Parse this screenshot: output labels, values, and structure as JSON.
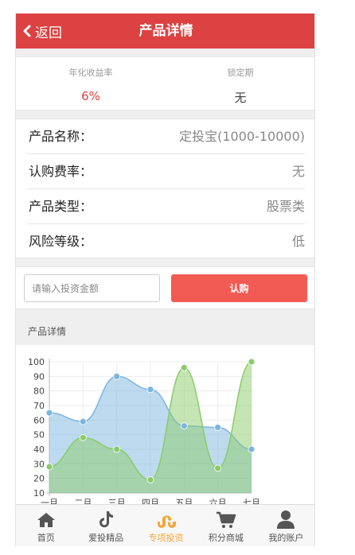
{
  "header": {
    "back_label": "返回",
    "title": "产品详情"
  },
  "rates": [
    {
      "label": "年化收益率",
      "value": "6%",
      "color": "#db4241"
    },
    {
      "label": "锁定期",
      "value": "无",
      "color": "#444444"
    }
  ],
  "info": [
    {
      "key": "产品名称：",
      "value": "定投宝(1000-10000)"
    },
    {
      "key": "认购费率：",
      "value": "无"
    },
    {
      "key": "产品类型：",
      "value": "股票类"
    },
    {
      "key": "风险等级：",
      "value": "低"
    }
  ],
  "buy": {
    "placeholder": "请输入投资金额",
    "button_label": "认购"
  },
  "section": {
    "title": "产品详情"
  },
  "chart_data": {
    "type": "area",
    "x": [
      "一月",
      "二月",
      "三月",
      "四月",
      "五月",
      "六月",
      "七月"
    ],
    "ylim": [
      10,
      100
    ],
    "yticks": [
      10,
      20,
      30,
      40,
      50,
      60,
      70,
      80,
      90,
      100
    ],
    "grid": true,
    "series": [
      {
        "values": [
          65,
          59,
          90,
          81,
          56,
          55,
          40
        ],
        "color": "#7bb5e0"
      },
      {
        "values": [
          28,
          48,
          40,
          19,
          96,
          27,
          100
        ],
        "color": "#8bcb6a"
      }
    ]
  },
  "tabs": [
    {
      "label": "首页",
      "icon": "home-icon",
      "active": false
    },
    {
      "label": "爱投精品",
      "icon": "tiktok-icon",
      "active": false
    },
    {
      "label": "专项投资",
      "icon": "stumbleupon-icon",
      "active": true
    },
    {
      "label": "积分商城",
      "icon": "cart-icon",
      "active": false
    },
    {
      "label": "我的账户",
      "icon": "user-icon",
      "active": false
    }
  ]
}
